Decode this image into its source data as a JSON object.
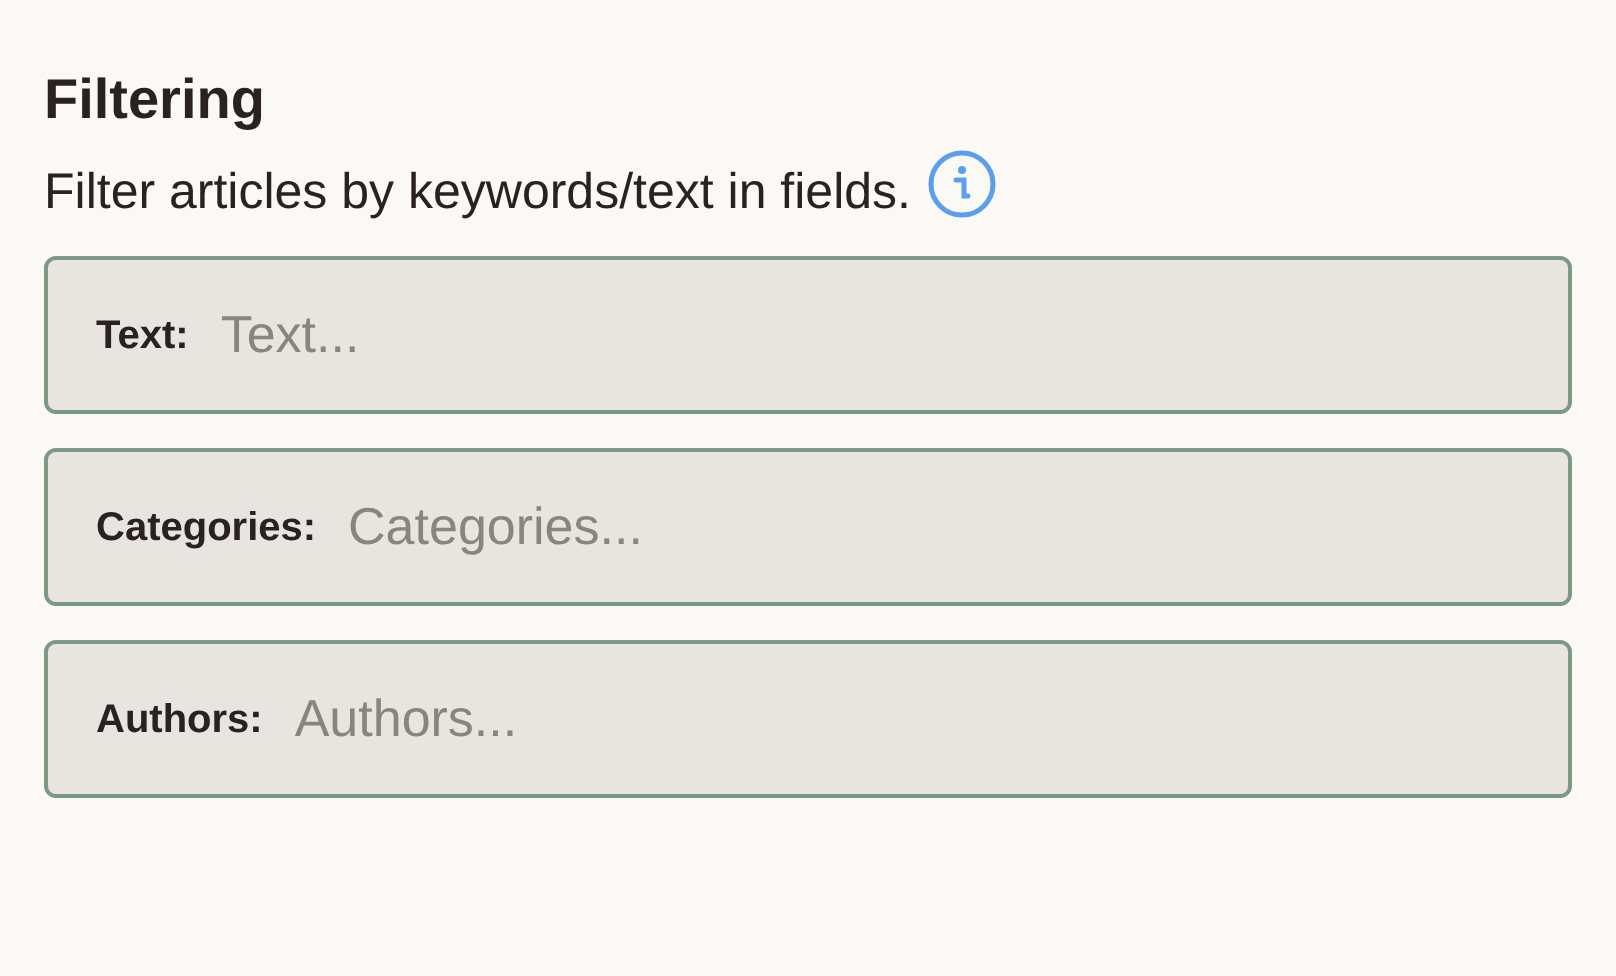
{
  "title": "Filtering",
  "description": "Filter articles by keywords/text in fields.",
  "fields": [
    {
      "label": "Text:",
      "placeholder": "Text..."
    },
    {
      "label": "Categories:",
      "placeholder": "Categories..."
    },
    {
      "label": "Authors:",
      "placeholder": "Authors..."
    }
  ]
}
